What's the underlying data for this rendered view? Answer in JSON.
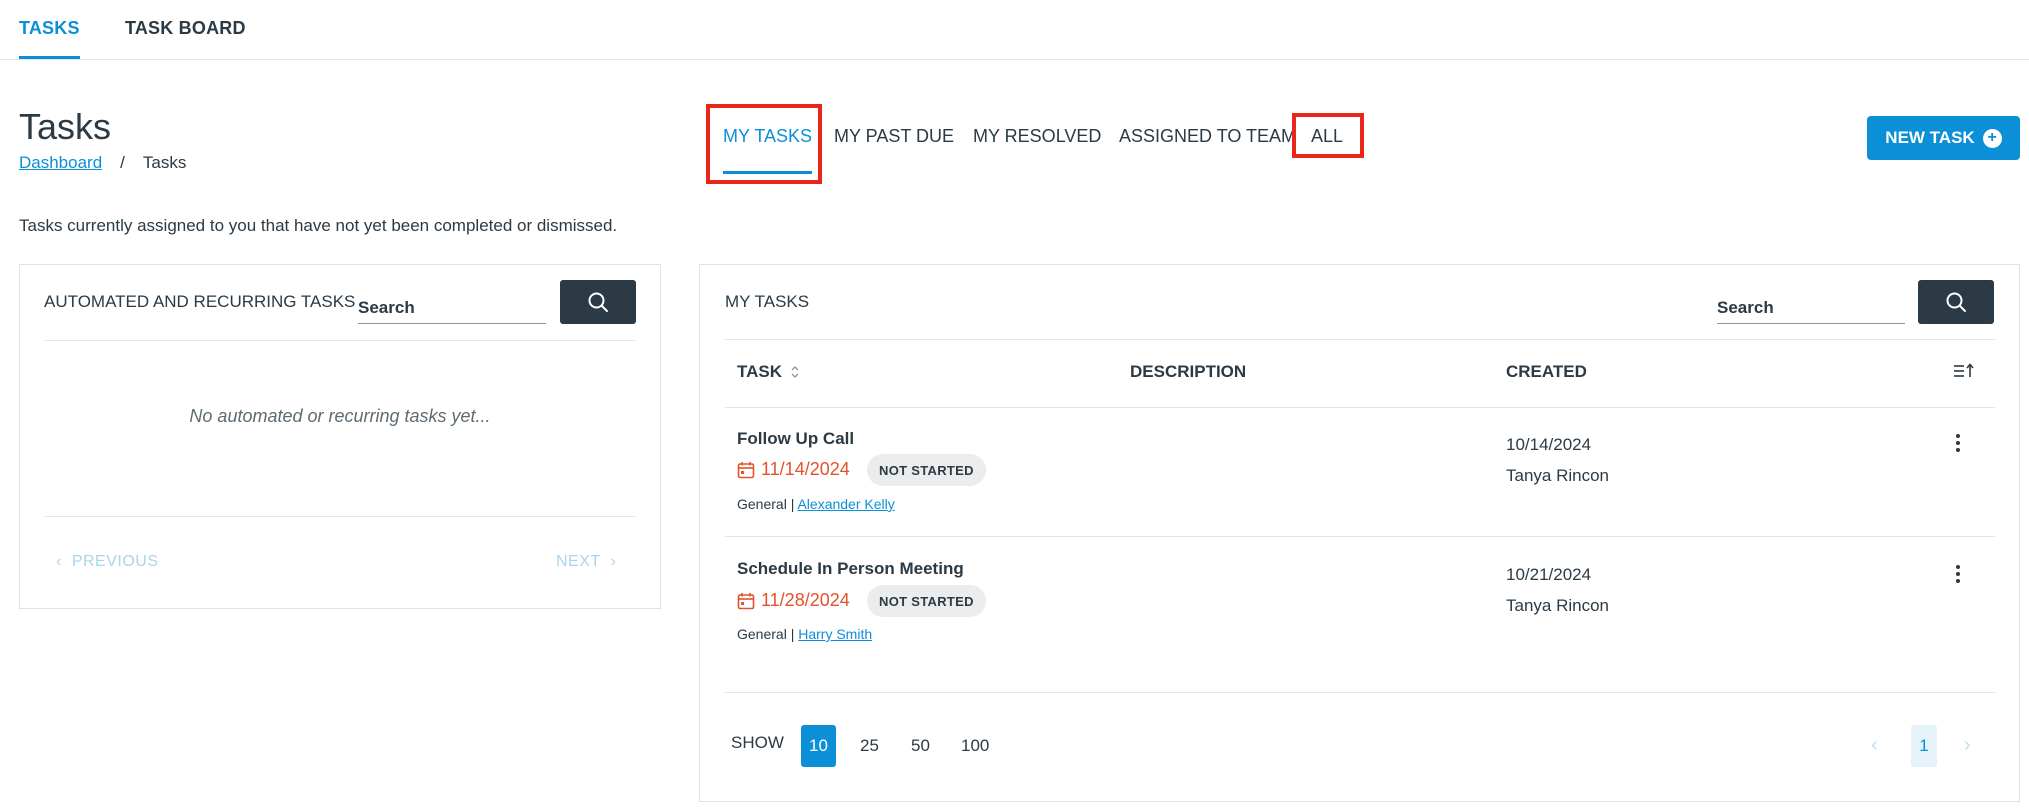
{
  "topnav": {
    "tabs": [
      {
        "label": "TASKS"
      },
      {
        "label": "TASK BOARD"
      }
    ]
  },
  "page": {
    "title": "Tasks",
    "breadcrumb": {
      "parent": "Dashboard",
      "separator": "/",
      "current": "Tasks"
    },
    "description": "Tasks currently assigned to you that have not yet been completed or dismissed."
  },
  "subtabs": [
    {
      "label": "MY TASKS"
    },
    {
      "label": "MY PAST DUE"
    },
    {
      "label": "MY RESOLVED"
    },
    {
      "label": "ASSIGNED TO TEAM"
    },
    {
      "label": "ALL"
    }
  ],
  "new_task": {
    "label": "NEW TASK",
    "icon": "plus-circle-icon"
  },
  "left_panel": {
    "title": "AUTOMATED AND RECURRING TASKS",
    "search_placeholder": "Search",
    "empty_message": "No automated or recurring tasks yet...",
    "previous_label": "PREVIOUS",
    "next_label": "NEXT"
  },
  "right_panel": {
    "title": "MY TASKS",
    "search_placeholder": "Search",
    "columns": {
      "task": "TASK",
      "description": "DESCRIPTION",
      "created": "CREATED"
    },
    "rows": [
      {
        "title": "Follow Up Call",
        "due": "11/14/2024",
        "status": "NOT STARTED",
        "category": "General",
        "contact": "Alexander Kelly",
        "created_date": "10/14/2024",
        "created_by": "Tanya Rincon"
      },
      {
        "title": "Schedule In Person Meeting",
        "due": "11/28/2024",
        "status": "NOT STARTED",
        "category": "General",
        "contact": "Harry Smith",
        "created_date": "10/21/2024",
        "created_by": "Tanya Rincon"
      }
    ],
    "show_label": "SHOW",
    "page_sizes": [
      "10",
      "25",
      "50",
      "100"
    ],
    "selected_page_size": "10",
    "current_page": "1"
  },
  "colors": {
    "accent": "#0b8fd6",
    "due": "#e3522b",
    "highlight": "#e8261a",
    "dark_button": "#2b3a45"
  }
}
